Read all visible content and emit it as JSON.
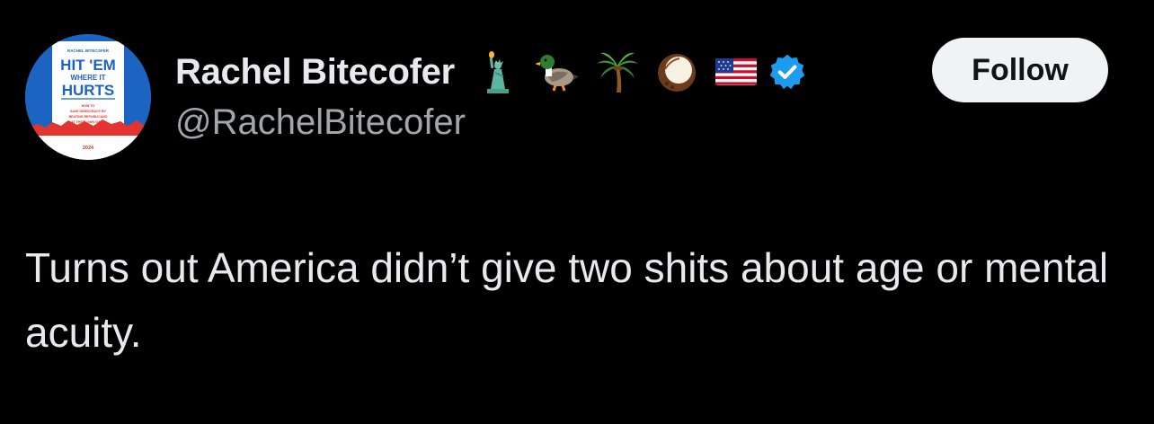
{
  "author": {
    "display_name": "Rachel Bitecofer",
    "handle": "@RachelBitecofer",
    "name_emojis": [
      "statue-of-liberty-icon",
      "duck-icon",
      "palm-tree-icon",
      "coconut-icon",
      "us-flag-icon"
    ],
    "verified_badge": "verified-badge-icon",
    "avatar": {
      "top_line": "RACHEL BITECOFER",
      "title_line1": "HIT 'EM",
      "title_line2": "WHERE IT",
      "title_line3": "HURTS",
      "sub_line1": "HOW TO",
      "sub_line2": "SAVE DEMOCRACY BY",
      "sub_line3": "BEATING REPUBLICANS",
      "sub_line4": "AT THEIR OWN GAME",
      "footer": "2024"
    }
  },
  "actions": {
    "follow_label": "Follow"
  },
  "tweet": {
    "text": "Turns out America didn’t give two shits about age or mental acuity."
  },
  "colors": {
    "background": "#000000",
    "text_primary": "#e7e9ea",
    "text_secondary": "#a0a6ab",
    "follow_button_bg": "#eff3f4",
    "verified_blue": "#1d9bf0"
  }
}
